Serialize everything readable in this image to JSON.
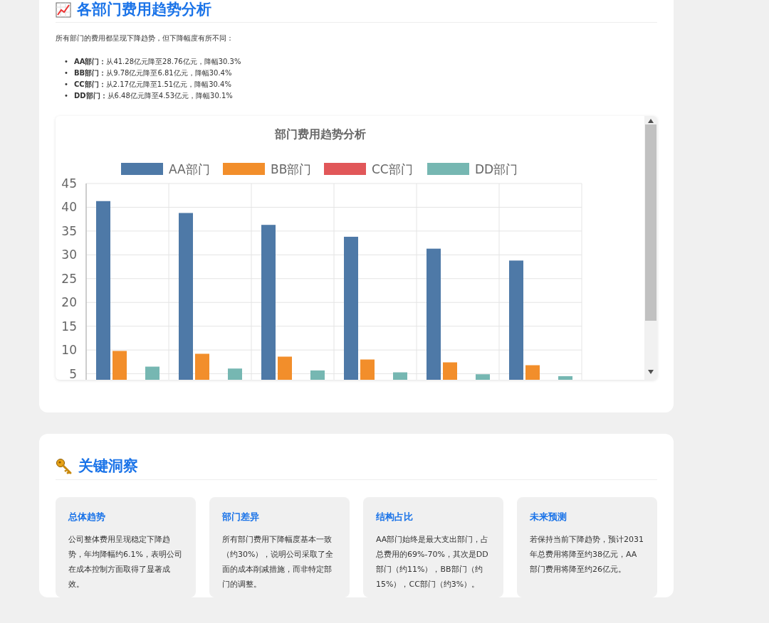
{
  "trend_section": {
    "title": "各部门费用趋势分析",
    "intro": "所有部门的费用都呈现下降趋势，但下降幅度有所不同：",
    "items": [
      {
        "marker": "•",
        "text": "**AA部门：**从41.28亿元降至28.76亿元，降幅30.3%"
      },
      {
        "marker": "•",
        "text": "**BB部门：**从9.78亿元降至6.81亿元，降幅30.4%"
      },
      {
        "marker": "•",
        "text": "**CC部门：**从2.17亿元降至1.51亿元，降幅30.4%"
      },
      {
        "marker": "•",
        "text": "**DD部门：**从6.48亿元降至4.53亿元，降幅30.1%"
      }
    ],
    "chart_data": {
      "type": "bar",
      "title": "部门费用趋势分析",
      "grid": true,
      "legend": true,
      "ylim": [
        0,
        45
      ],
      "yticks": [
        5,
        10,
        15,
        20,
        25,
        30,
        35,
        40,
        45
      ],
      "series": [
        {
          "name": "AA部门",
          "color": "#4e79a7",
          "values": [
            41.3,
            38.8,
            36.3,
            33.8,
            31.3,
            28.8
          ]
        },
        {
          "name": "BB部门",
          "color": "#f28e2b",
          "values": [
            9.8,
            9.2,
            8.6,
            8.0,
            7.4,
            6.8
          ]
        },
        {
          "name": "CC部门",
          "color": "#e15759",
          "values": [
            null,
            null,
            null,
            null,
            null,
            null
          ]
        },
        {
          "name": "DD部门",
          "color": "#76b7b2",
          "values": [
            6.5,
            6.1,
            5.7,
            5.3,
            4.9,
            4.5
          ]
        }
      ]
    }
  },
  "insight_section": {
    "title": "关键洞察",
    "cards": [
      {
        "title": "总体趋势",
        "text": "公司整体费用呈现稳定下降趋势，年均降幅约6.1%，表明公司在成本控制方面取得了显著成效。"
      },
      {
        "title": "部门差异",
        "text": "所有部门费用下降幅度基本一致（约30%），说明公司采取了全面的成本削减措施，而非特定部门的调整。"
      },
      {
        "title": "结构占比",
        "text": "AA部门始终是最大支出部门，占总费用的69%-70%，其次是DD部门（约11%），BB部门（约15%），CC部门（约3%）。"
      },
      {
        "title": "未来预测",
        "text": "若保持当前下降趋势，预计2031年总费用将降至约38亿元，AA部门费用将降至约26亿元。"
      }
    ]
  }
}
